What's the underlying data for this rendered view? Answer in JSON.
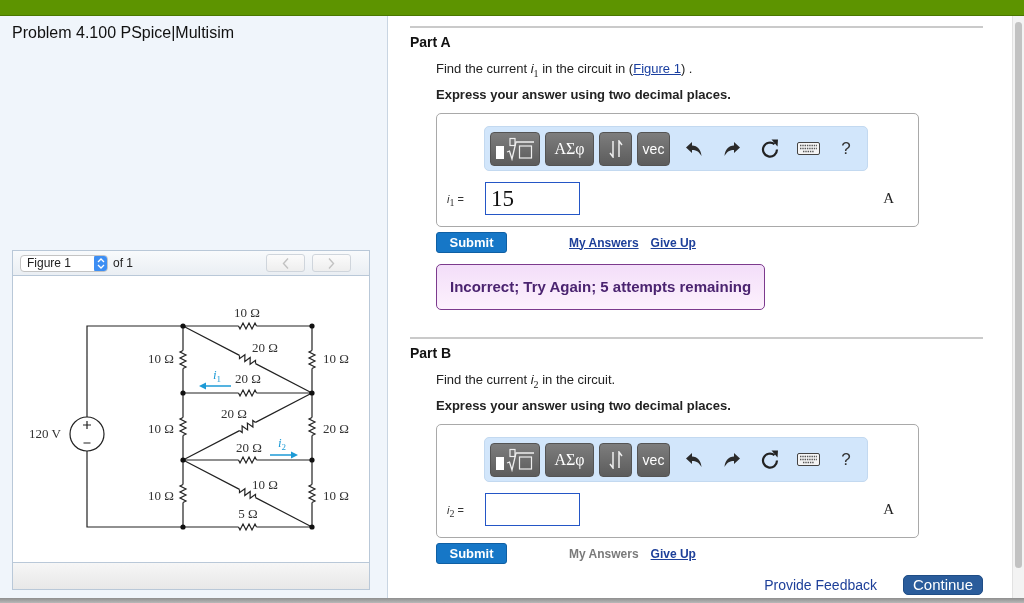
{
  "problem": {
    "title": "Problem 4.100 PSpice|Multisim"
  },
  "figure_viewer": {
    "select": {
      "value": "Figure 1"
    },
    "count": "of 1",
    "nav_buttons": [
      {
        "kind": "previous",
        "disabled": true
      },
      {
        "kind": "next",
        "disabled": true
      }
    ],
    "circuit": {
      "source": {
        "label": "120 V"
      },
      "resistors": [
        {
          "label": "10 Ω"
        },
        {
          "label": "20 Ω"
        },
        {
          "label": "10 Ω"
        },
        {
          "label": "10 Ω"
        },
        {
          "label": "20 Ω"
        },
        {
          "label": "20 Ω"
        },
        {
          "label": "10 Ω"
        },
        {
          "label": "20 Ω"
        },
        {
          "label": "20 Ω"
        },
        {
          "label": "10 Ω"
        },
        {
          "label": "10 Ω"
        },
        {
          "label": "10 Ω"
        },
        {
          "label": "5 Ω"
        }
      ],
      "currents": [
        {
          "label": "*i*$_{1}$"
        },
        {
          "label": "*i*$_{2}$"
        }
      ]
    }
  },
  "parts": [
    {
      "title": "Part A",
      "prompt": {
        "text": "Find the current *i*$_{1}$ in the circuit in (",
        "link": "Figure 1",
        "after": ") ."
      },
      "instruction": "Express your answer using two decimal places.",
      "toolbar": [
        {
          "kind": "templates"
        },
        {
          "kind": "symbols",
          "label": "ΑΣφ"
        },
        {
          "kind": "arrows"
        },
        {
          "kind": "text",
          "label": "vec"
        },
        {
          "kind": "undo"
        },
        {
          "kind": "redo"
        },
        {
          "kind": "reset"
        },
        {
          "kind": "keyboard"
        },
        {
          "kind": "help",
          "label": "?"
        }
      ],
      "variable": "*i*$_{1}$ =",
      "answer": {
        "value": "15"
      },
      "unit": "A",
      "submit": "Submit",
      "links": [
        {
          "label": "My Answers",
          "disabled": false
        },
        {
          "label": "Give Up",
          "disabled": false
        }
      ],
      "feedback": "Incorrect; Try Again; 5 attempts remaining"
    },
    {
      "title": "Part B",
      "prompt": {
        "text": "Find the current *i*$_{2}$ in the circuit."
      },
      "instruction": "Express your answer using two decimal places.",
      "toolbar": [
        {
          "kind": "templates"
        },
        {
          "kind": "symbols",
          "label": "ΑΣφ"
        },
        {
          "kind": "arrows"
        },
        {
          "kind": "text",
          "label": "vec"
        },
        {
          "kind": "undo"
        },
        {
          "kind": "redo"
        },
        {
          "kind": "reset"
        },
        {
          "kind": "keyboard"
        },
        {
          "kind": "help",
          "label": "?"
        }
      ],
      "variable": "*i*$_{2}$ =",
      "unit": "A",
      "submit": "Submit",
      "links": [
        {
          "label": "My Answers",
          "disabled": true
        },
        {
          "label": "Give Up",
          "disabled": false
        }
      ]
    }
  ],
  "footer": {
    "link": "Provide Feedback",
    "button": "Continue"
  }
}
